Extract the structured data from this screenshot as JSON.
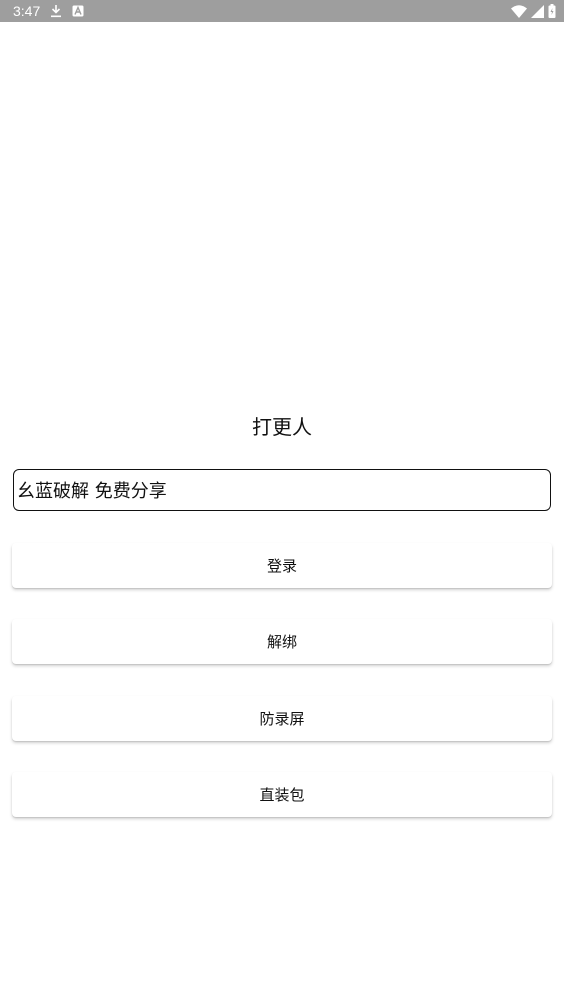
{
  "status_bar": {
    "time": "3:47",
    "icons": [
      "download-icon",
      "a-notification-icon",
      "wifi-icon",
      "signal-icon",
      "battery-icon"
    ]
  },
  "app": {
    "title": "打更人",
    "input_value": "幺蓝破解 免费分享"
  },
  "buttons": {
    "login": "登录",
    "unbind": "解绑",
    "anti_record": "防录屏",
    "direct_install": "直装包"
  }
}
